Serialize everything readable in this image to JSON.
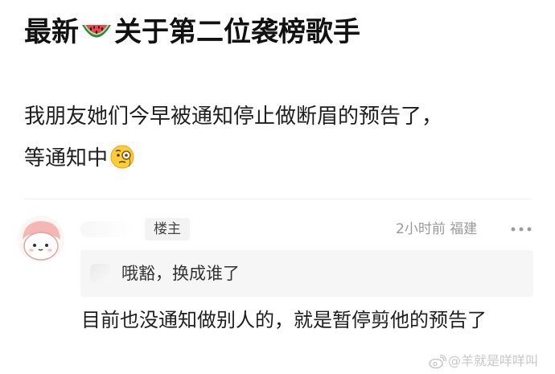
{
  "post": {
    "title_before": "最新",
    "title_emoji": "watermelon-emoji",
    "title_after": "关于第二位袭榜歌手",
    "body_line1": "我朋友她们今早被通知停止做断眉的预告了，",
    "body_line2": "等通知中",
    "body_emoji": "monocle-face-emoji"
  },
  "comment": {
    "badge": "楼主",
    "time": "2小时前",
    "location": "福建",
    "quote_text": "哦豁，换成谁了",
    "reply_text": "目前也没通知做别人的，就是暂停剪他的预告了"
  },
  "watermark": {
    "text": "@羊就是咩咩叫"
  },
  "colors": {
    "text": "#1b1b1b",
    "meta": "#9a9a9a",
    "quote_bg": "#f6f6f6",
    "badge_bg": "#f3f3f3",
    "avatar_pink": "#f4b7b4"
  }
}
